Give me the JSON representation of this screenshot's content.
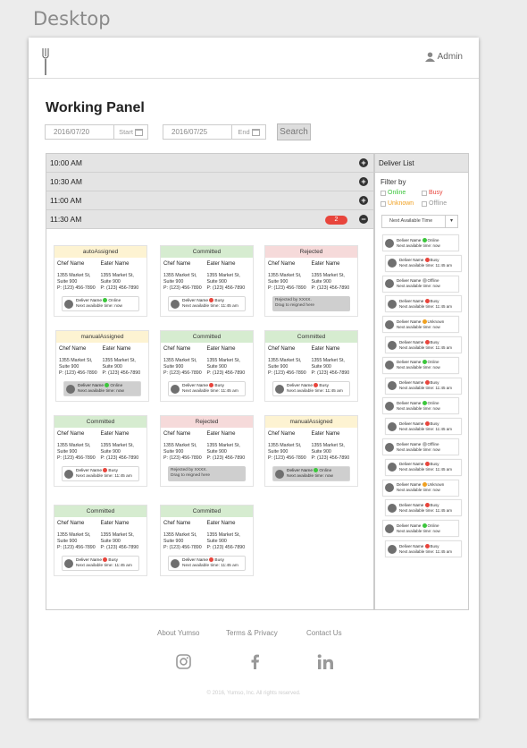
{
  "canvas_label": "Desktop",
  "header": {
    "admin_label": "Admin"
  },
  "page_title": "Working Panel",
  "filters": {
    "start_value": "2016/07/20",
    "start_label": "Start",
    "end_value": "2016/07/25",
    "end_label": "End",
    "search_label": "Search"
  },
  "slots": [
    {
      "time": "10:00 AM"
    },
    {
      "time": "10:30 AM"
    },
    {
      "time": "11:00 AM"
    },
    {
      "time": "11:30 AM",
      "count": "2"
    }
  ],
  "card_text": {
    "chef_header": "Chef Name",
    "eater_header": "Eater Name",
    "addr1": "1355 Market St,",
    "addr2": "Suite 900",
    "phone": "P: (123) 456-7890",
    "deliver_name": "Deliver Name",
    "rejected_line1": "Rejected by XXXX.",
    "rejected_line2": "Drag to reigned here"
  },
  "cards": [
    {
      "status": "autoAssigned",
      "style": "auto",
      "driver_status": "Online",
      "dot": "#3cc63c",
      "next": "Next available time: now",
      "box": "white"
    },
    {
      "status": "Committed",
      "style": "committed",
      "driver_status": "Busy",
      "dot": "#e8453c",
      "next": "Next available time: 11:45 am",
      "box": "white"
    },
    {
      "status": "Rejected",
      "style": "rejected",
      "box": "rejected"
    },
    {
      "status": "manualAssigned",
      "style": "auto",
      "driver_status": "Online",
      "dot": "#3cc63c",
      "next": "Next available time: now",
      "box": "grey"
    },
    {
      "status": "Committed",
      "style": "committed",
      "driver_status": "Busy",
      "dot": "#e8453c",
      "next": "Next available time: 11:45 am",
      "box": "white"
    },
    {
      "status": "Committed",
      "style": "committed",
      "driver_status": "Busy",
      "dot": "#e8453c",
      "next": "Next available time: 11:45 am",
      "box": "white"
    },
    {
      "status": "Committed",
      "style": "committed",
      "driver_status": "Busy",
      "dot": "#e8453c",
      "next": "Next available time: 11:45 am",
      "box": "white"
    },
    {
      "status": "Rejected",
      "style": "rejected",
      "box": "rejected"
    },
    {
      "status": "manualAssigned",
      "style": "auto",
      "driver_status": "Online",
      "dot": "#3cc63c",
      "next": "Next available time: now",
      "box": "grey"
    },
    {
      "status": "Committed",
      "style": "committed",
      "driver_status": "Busy",
      "dot": "#e8453c",
      "next": "Next available time: 11:45 am",
      "box": "white"
    },
    {
      "status": "Committed",
      "style": "committed",
      "driver_status": "Busy",
      "dot": "#e8453c",
      "next": "Next available time: 11:45 am",
      "box": "white"
    }
  ],
  "deliver_list": {
    "title": "Deliver List",
    "filter_title": "Filter by",
    "filter_options": [
      {
        "label": "Online",
        "color": "#3cc63c"
      },
      {
        "label": "Busy",
        "color": "#e8453c"
      },
      {
        "label": "Unknown",
        "color": "#f0a020"
      },
      {
        "label": "Offline",
        "color": "#999999"
      }
    ],
    "sort_label": "Next Available Time",
    "drivers": [
      {
        "status": "Online",
        "dot": "#3cc63c",
        "next": "Next available time: now"
      },
      {
        "status": "Busy",
        "dot": "#e8453c",
        "next": "Next available time: 11:45 am"
      },
      {
        "status": "Offline",
        "dot": "#bbbbbb",
        "next": "Next available time: now"
      },
      {
        "status": "Busy",
        "dot": "#e8453c",
        "next": "Next available time: 11:45 am"
      },
      {
        "status": "Unknown",
        "dot": "#f0a020",
        "next": "Next available time: now"
      },
      {
        "status": "Busy",
        "dot": "#e8453c",
        "next": "Next available time: 11:45 am"
      },
      {
        "status": "Online",
        "dot": "#3cc63c",
        "next": "Next available time: now"
      },
      {
        "status": "Busy",
        "dot": "#e8453c",
        "next": "Next available time: 11:45 am"
      },
      {
        "status": "Online",
        "dot": "#3cc63c",
        "next": "Next available time: now"
      },
      {
        "status": "Busy",
        "dot": "#e8453c",
        "next": "Next available time: 11:45 am"
      },
      {
        "status": "Offline",
        "dot": "#bbbbbb",
        "next": "Next available time: now"
      },
      {
        "status": "Busy",
        "dot": "#e8453c",
        "next": "Next available time: 11:45 am"
      },
      {
        "status": "Unknown",
        "dot": "#f0a020",
        "next": "Next available time: now"
      },
      {
        "status": "Busy",
        "dot": "#e8453c",
        "next": "Next available time: 11:45 am"
      },
      {
        "status": "Online",
        "dot": "#3cc63c",
        "next": "Next available time: now"
      },
      {
        "status": "Busy",
        "dot": "#e8453c",
        "next": "Next available time: 11:45 am"
      }
    ]
  },
  "footer": {
    "links": [
      "About Yumso",
      "Terms & Privacy",
      "Contact Us"
    ],
    "social": [
      "instagram-icon",
      "facebook-icon",
      "linkedin-icon"
    ],
    "copyright": "© 2016, Yumso, Inc.  All rights reserved."
  }
}
